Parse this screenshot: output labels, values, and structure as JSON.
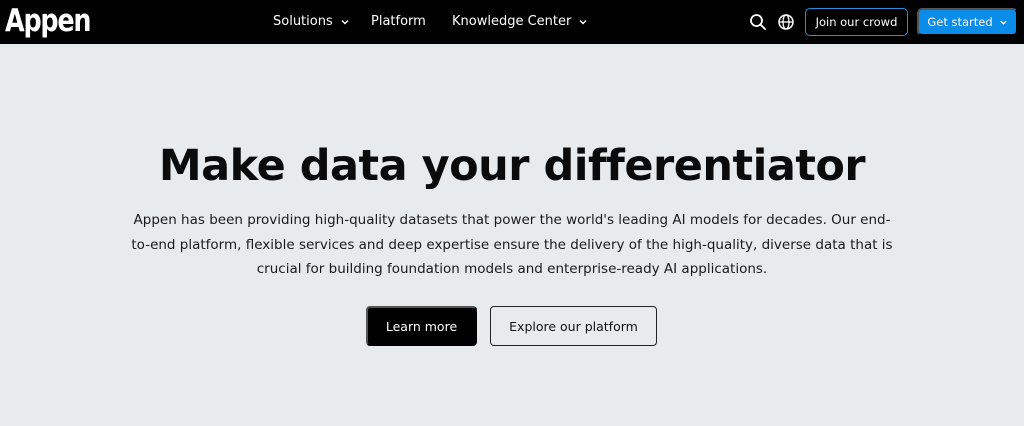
{
  "header": {
    "logo": "Appen",
    "nav": [
      {
        "label": "Solutions",
        "has_dropdown": true
      },
      {
        "label": "Platform",
        "has_dropdown": false
      },
      {
        "label": "Knowledge Center",
        "has_dropdown": true
      }
    ],
    "icons": {
      "search": "search-icon",
      "language": "globe-icon"
    },
    "join_label": "Join our crowd",
    "get_started_label": "Get started"
  },
  "hero": {
    "title": "Make data your differentiator",
    "description_lines": [
      "Appen has been providing high-quality datasets that power the world's leading AI models for decades. Our end-",
      "to-end platform, flexible services and deep expertise ensure the delivery of the high-quality, diverse data that is",
      "crucial for building foundation models and enterprise-ready AI applications."
    ],
    "primary_cta": "Learn more",
    "secondary_cta": "Explore our platform"
  },
  "colors": {
    "header_bg": "#000000",
    "page_bg": "#e8ebee",
    "accent_blue": "#0a8ce8",
    "join_border": "#2b8fd8",
    "primary_button_bg": "#000000"
  }
}
